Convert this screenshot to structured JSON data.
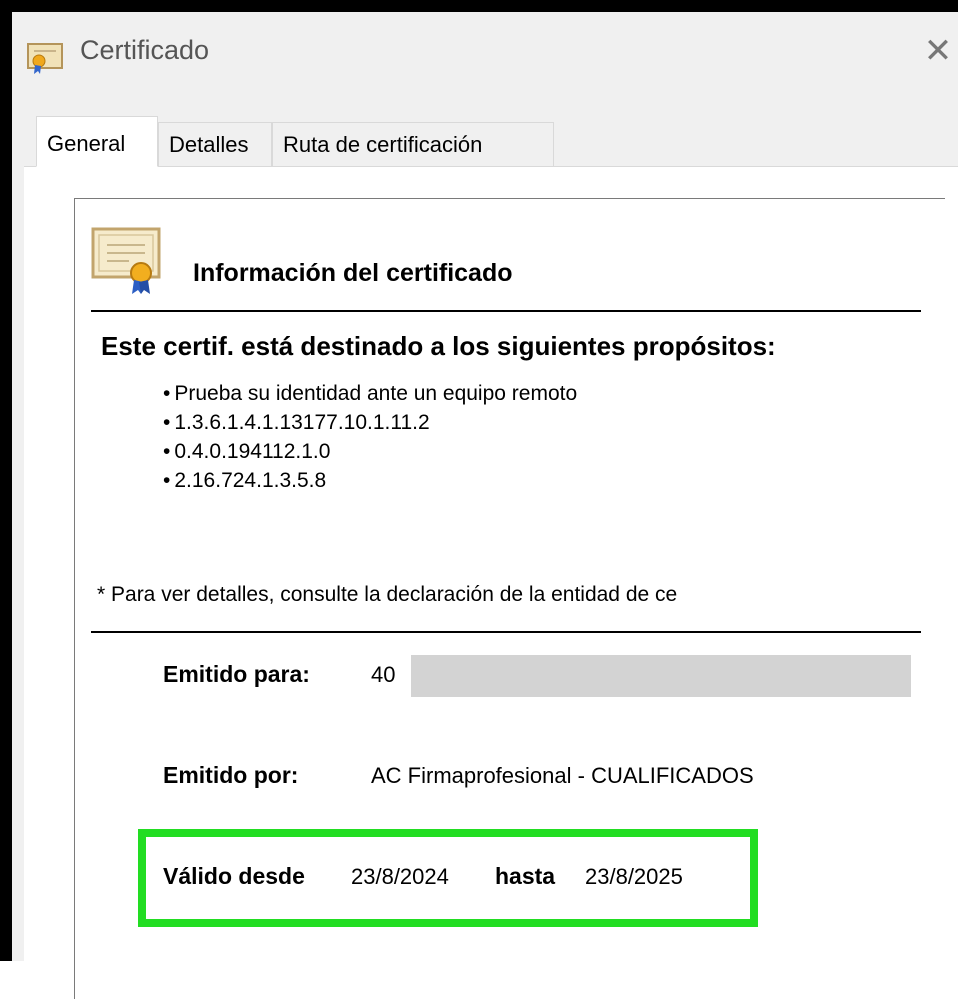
{
  "window": {
    "title": "Certificado",
    "close_glyph": "✕"
  },
  "tabs": [
    {
      "label": "General",
      "active": true
    },
    {
      "label": "Detalles",
      "active": false
    },
    {
      "label": "Ruta de certificación",
      "active": false
    }
  ],
  "general": {
    "info_title": "Información del certificado",
    "purposes_heading": "Este certif. está destinado a los siguientes propósitos:",
    "purposes": [
      "Prueba su identidad ante un equipo remoto",
      "1.3.6.1.4.1.13177.10.1.11.2",
      "0.4.0.194112.1.0",
      "2.16.724.1.3.5.8"
    ],
    "note": "* Para ver detalles, consulte la declaración de la entidad de ce",
    "issued_to_label": "Emitido para:",
    "issued_to_value": "40",
    "issued_by_label": "Emitido por:",
    "issued_by_value": "AC Firmaprofesional - CUALIFICADOS",
    "valid_from_label": "Válido desde",
    "valid_from_value": "23/8/2024",
    "valid_to_label": "hasta",
    "valid_to_value": "23/8/2025"
  },
  "icons": {
    "title": "certificate-icon",
    "info": "certificate-icon",
    "close": "close-icon"
  },
  "colors": {
    "highlight": "#22dd22",
    "redaction": "#d3d3d3"
  }
}
